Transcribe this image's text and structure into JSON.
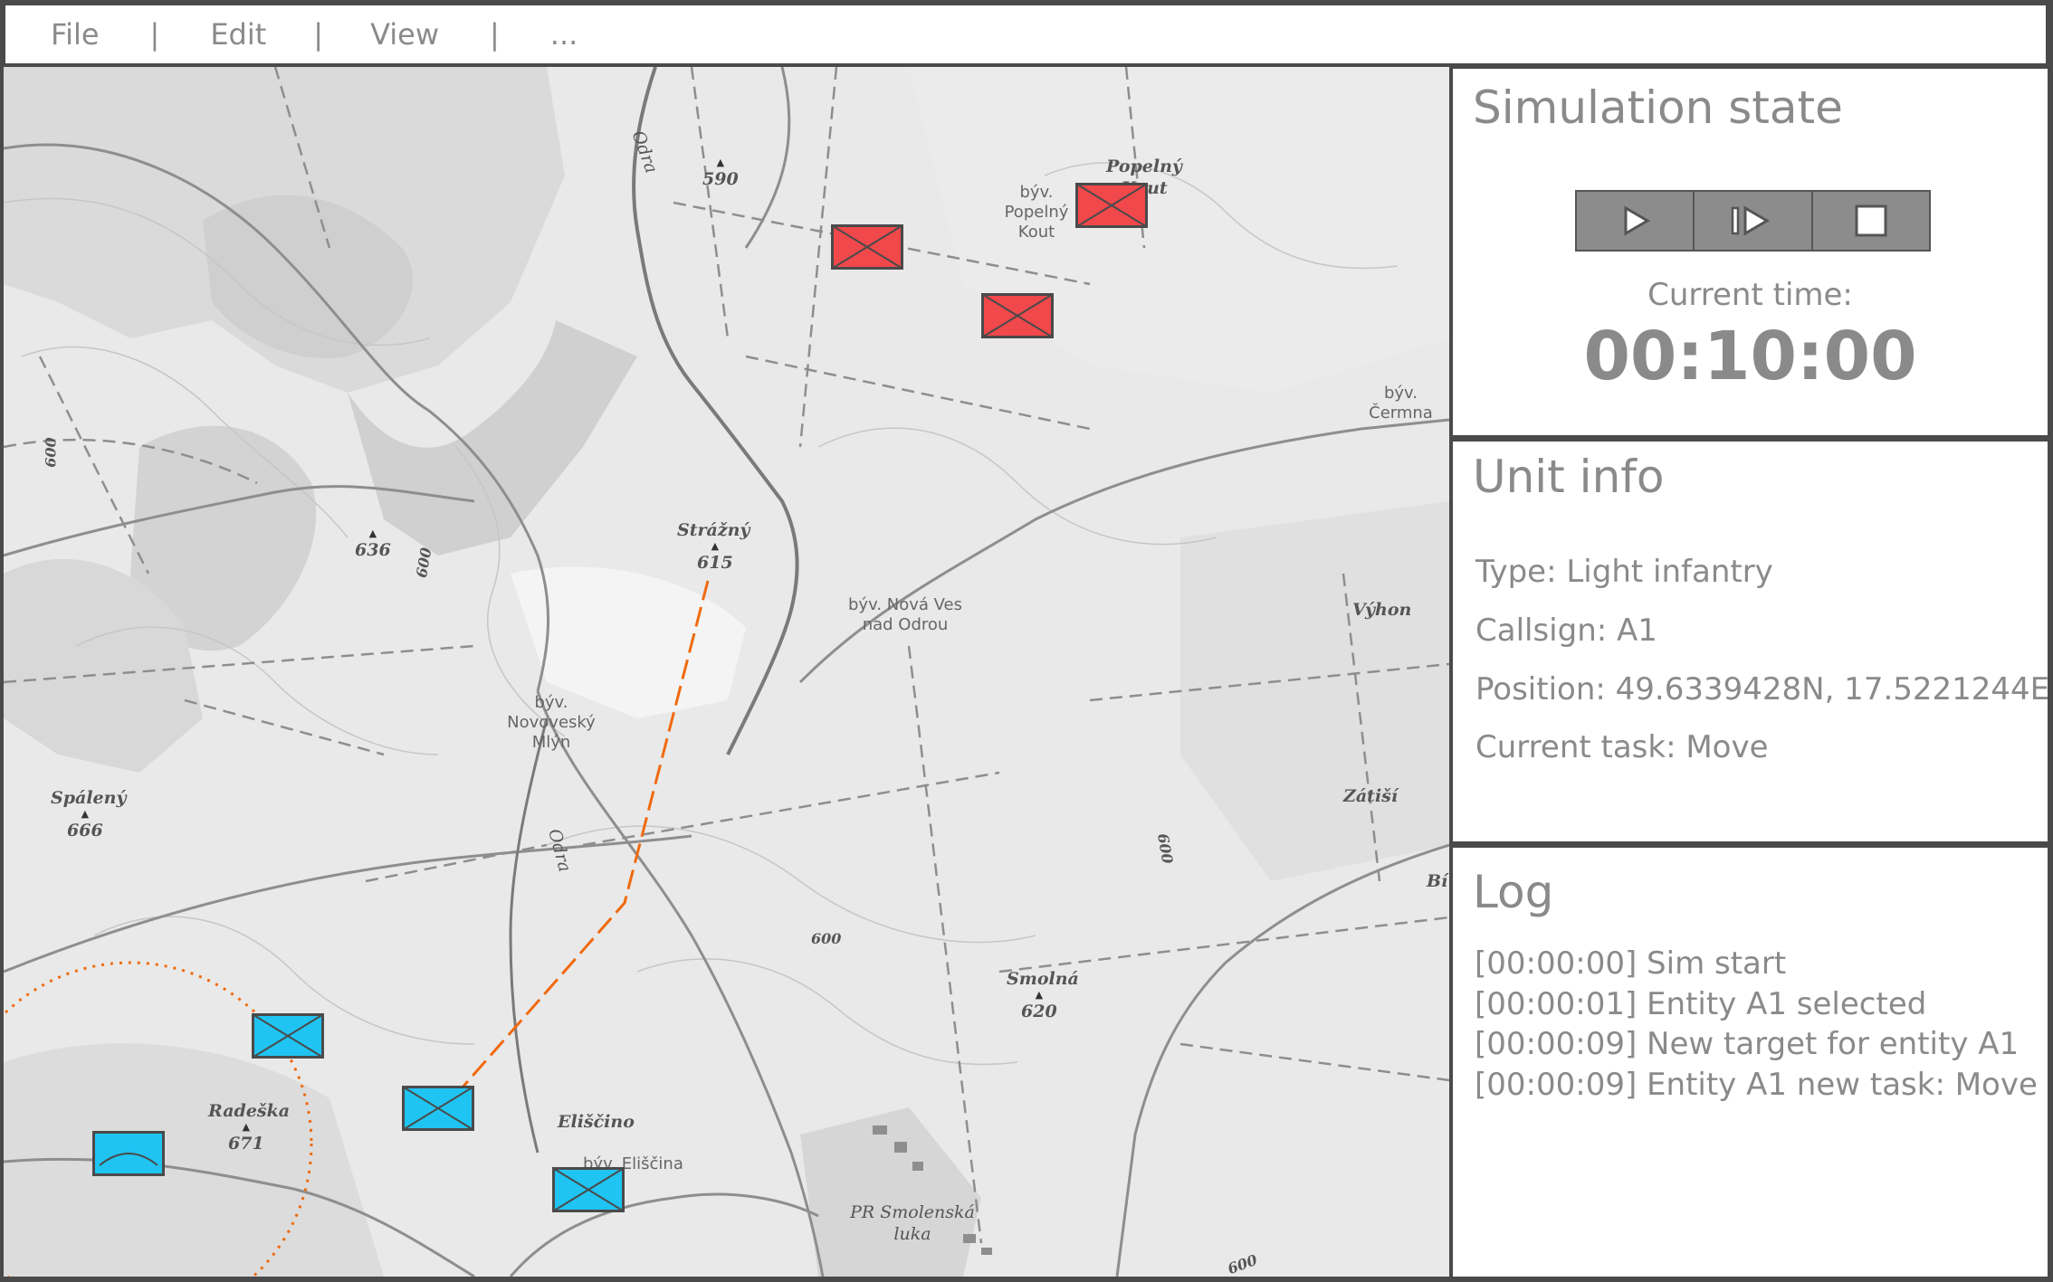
{
  "menu": {
    "items": [
      "File",
      "Edit",
      "View",
      "..."
    ],
    "separator": "|"
  },
  "map": {
    "labels": {
      "peak_590": "590",
      "byv_popelny_kout": "býv. Popelný Kout",
      "popelny_kout": "Popelný Kout",
      "byv_cermna": "býv. Čermna",
      "odra_north": "Odra",
      "strazny": "Strážný",
      "peak_615": "615",
      "peak_636": "636",
      "contour_600_a": "600",
      "contour_600_b": "600",
      "byv_nova_ves": "býv. Nová Ves nad Odrou",
      "byv_novovesky_mlyn": "býv. Novoveský Mlýn",
      "vyhon": "Výhon",
      "spaleny": "Spálený",
      "peak_666": "666",
      "odra_south": "Odra",
      "zatisi": "Zátiší",
      "contour_600_c": "600",
      "contour_600_d": "600",
      "smolna": "Smolná",
      "peak_620": "620",
      "radeska": "Radeška",
      "peak_671": "671",
      "eliscino": "Eliščino",
      "byv_eliscina": "býv. Eliščina",
      "pr_smolenska_luka": "PR Smolenská luka",
      "contour_600_e": "600",
      "bi_edge": "Bí"
    },
    "units": {
      "hostile": [
        "hostile-infantry",
        "hostile-infantry",
        "hostile-infantry"
      ],
      "friendly": [
        "friendly-infantry",
        "friendly-infantry-selected",
        "friendly-infantry",
        "friendly-armor"
      ]
    },
    "colors": {
      "hostile": "#f0484b",
      "friendly": "#1fc4f2",
      "route": "#f06a10",
      "unit_outline": "#4a4a4a"
    }
  },
  "simulation": {
    "title": "Simulation state",
    "controls": [
      "play-icon",
      "step-icon",
      "stop-icon"
    ],
    "time_label": "Current time:",
    "time_value": "00:10:00"
  },
  "unit_info": {
    "title": "Unit info",
    "type": "Type: Light infantry",
    "callsign": "Callsign: A1",
    "position": "Position: 49.6339428N, 17.5221244E",
    "task": "Current task: Move"
  },
  "log": {
    "title": "Log",
    "entries": [
      "[00:00:00] Sim start",
      "[00:00:01] Entity A1 selected",
      "[00:00:09] New target for entity A1",
      "[00:00:09] Entity A1 new task: Move"
    ]
  }
}
